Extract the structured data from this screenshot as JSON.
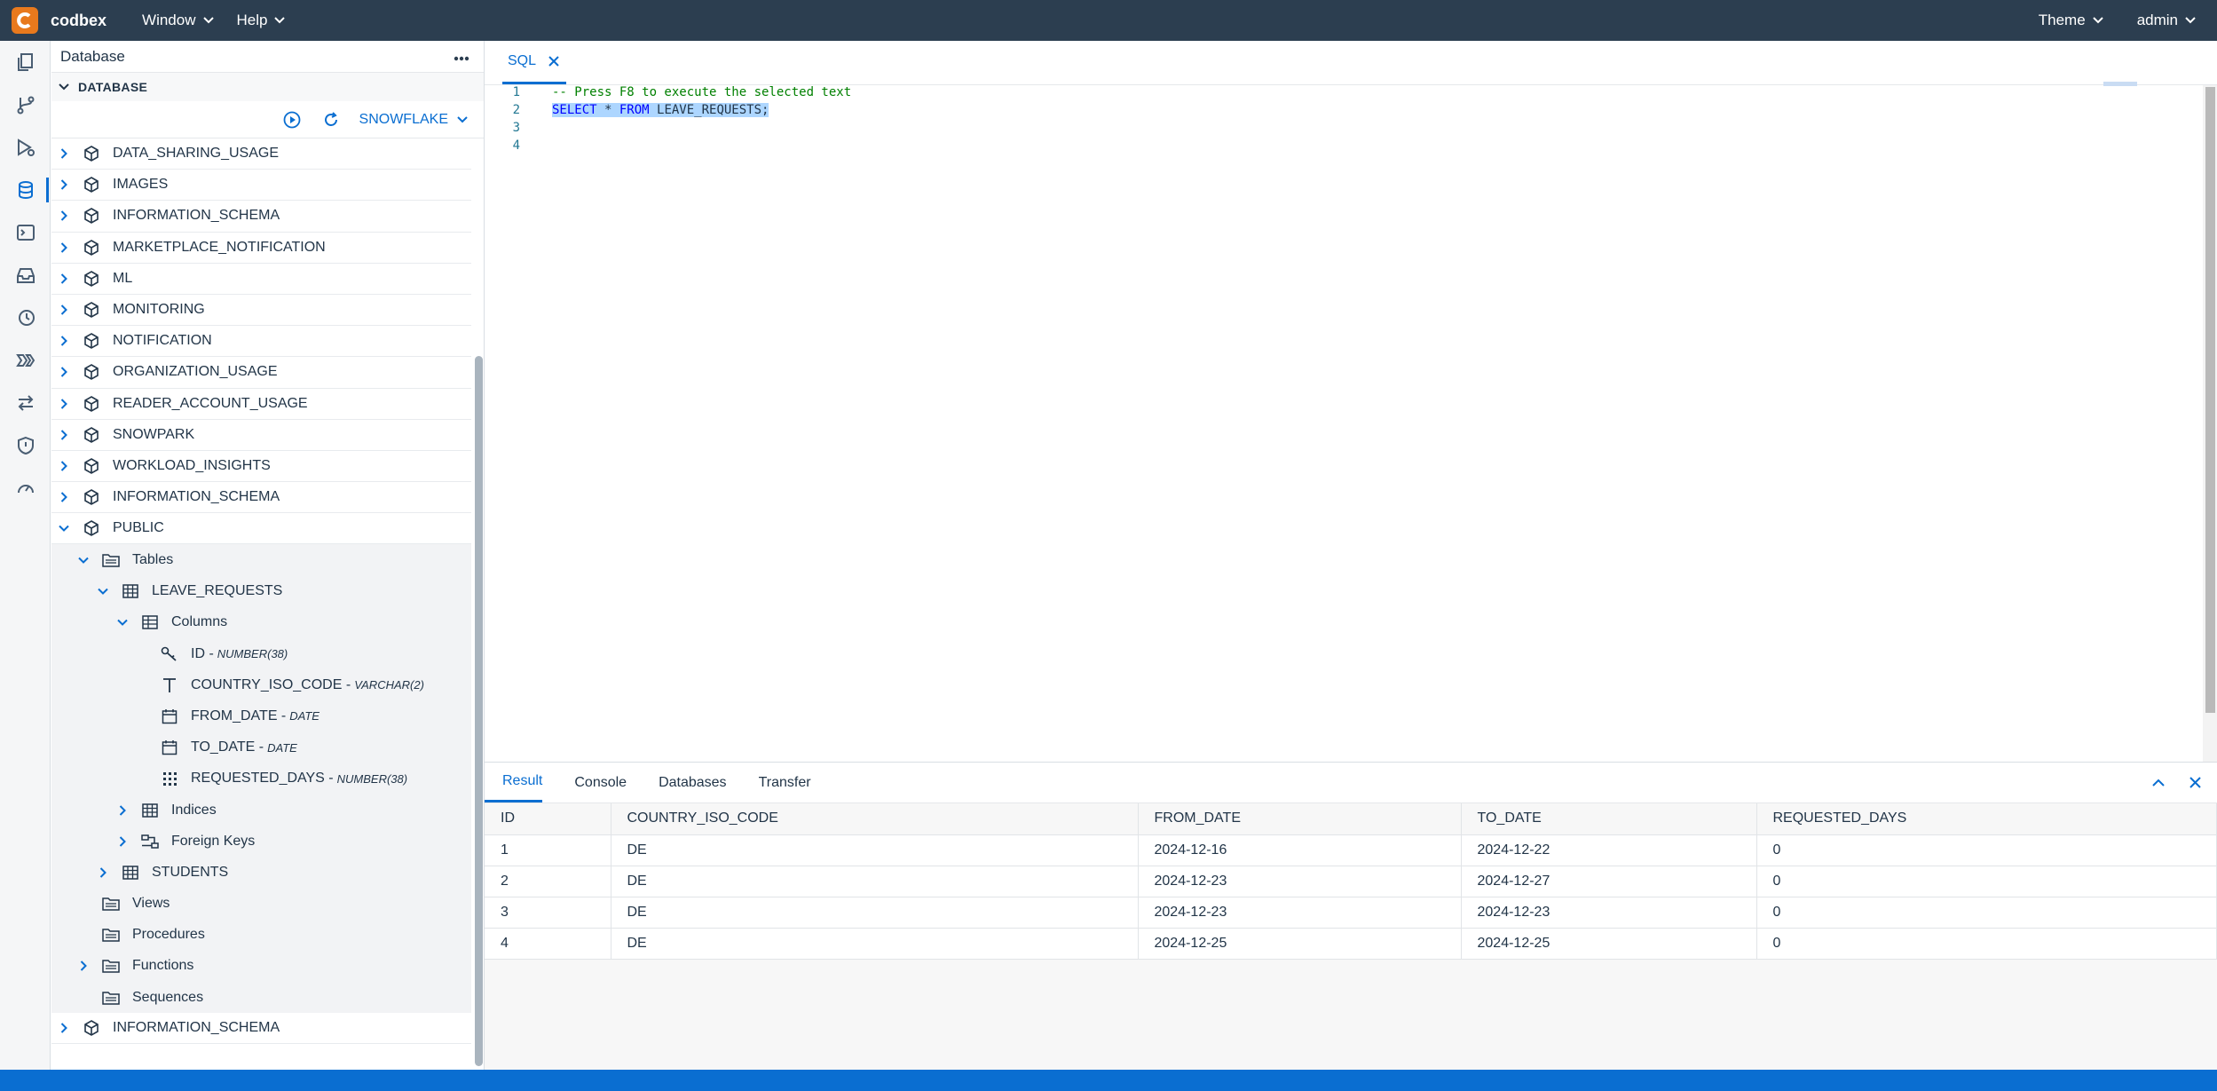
{
  "app": {
    "name": "codbex",
    "menus": [
      "Window",
      "Help"
    ],
    "theme_label": "Theme",
    "user_label": "admin"
  },
  "sidebar": {
    "title": "Database",
    "section": "DATABASE",
    "database_select": "SNOWFLAKE",
    "tree": [
      {
        "label": "DATA_SHARING_USAGE",
        "level": 0,
        "icon": "schema-icon",
        "expanded": false
      },
      {
        "label": "IMAGES",
        "level": 0,
        "icon": "schema-icon",
        "expanded": false
      },
      {
        "label": "INFORMATION_SCHEMA",
        "level": 0,
        "icon": "schema-icon",
        "expanded": false
      },
      {
        "label": "MARKETPLACE_NOTIFICATION",
        "level": 0,
        "icon": "schema-icon",
        "expanded": false
      },
      {
        "label": "ML",
        "level": 0,
        "icon": "schema-icon",
        "expanded": false
      },
      {
        "label": "MONITORING",
        "level": 0,
        "icon": "schema-icon",
        "expanded": false
      },
      {
        "label": "NOTIFICATION",
        "level": 0,
        "icon": "schema-icon",
        "expanded": false
      },
      {
        "label": "ORGANIZATION_USAGE",
        "level": 0,
        "icon": "schema-icon",
        "expanded": false
      },
      {
        "label": "READER_ACCOUNT_USAGE",
        "level": 0,
        "icon": "schema-icon",
        "expanded": false
      },
      {
        "label": "SNOWPARK",
        "level": 0,
        "icon": "schema-icon",
        "expanded": false
      },
      {
        "label": "WORKLOAD_INSIGHTS",
        "level": 0,
        "icon": "schema-icon",
        "expanded": false
      },
      {
        "label": "INFORMATION_SCHEMA",
        "level": 0,
        "icon": "schema-icon",
        "expanded": false
      },
      {
        "label": "PUBLIC",
        "level": 0,
        "icon": "schema-icon",
        "expanded": true
      },
      {
        "label": "Tables",
        "level": 1,
        "icon": "folder-icon",
        "expanded": true,
        "shade": true
      },
      {
        "label": "LEAVE_REQUESTS",
        "level": 2,
        "icon": "table-icon",
        "expanded": true,
        "shade": true
      },
      {
        "label": "Columns",
        "level": 3,
        "icon": "columns-icon",
        "expanded": true,
        "shade": true
      },
      {
        "label": "ID",
        "type": "NUMBER(38)",
        "level": 4,
        "icon": "key-icon",
        "leaf": true,
        "shade": true
      },
      {
        "label": "COUNTRY_ISO_CODE",
        "type": "VARCHAR(2)",
        "level": 4,
        "icon": "text-type-icon",
        "leaf": true,
        "shade": true
      },
      {
        "label": "FROM_DATE",
        "type": "DATE",
        "level": 4,
        "icon": "calendar-icon",
        "leaf": true,
        "shade": true
      },
      {
        "label": "TO_DATE",
        "type": "DATE",
        "level": 4,
        "icon": "calendar-icon",
        "leaf": true,
        "shade": true
      },
      {
        "label": "REQUESTED_DAYS",
        "type": "NUMBER(38)",
        "level": 4,
        "icon": "number-grid-icon",
        "leaf": true,
        "shade": true
      },
      {
        "label": "Indices",
        "level": 3,
        "icon": "table-icon",
        "expanded": false,
        "shade": true
      },
      {
        "label": "Foreign Keys",
        "level": 3,
        "icon": "foreign-key-icon",
        "expanded": false,
        "shade": true
      },
      {
        "label": "STUDENTS",
        "level": 2,
        "icon": "table-icon",
        "expanded": false,
        "shade": true
      },
      {
        "label": "Views",
        "level": 1,
        "icon": "folder-icon",
        "leaf": true,
        "shade": true
      },
      {
        "label": "Procedures",
        "level": 1,
        "icon": "folder-icon",
        "leaf": true,
        "shade": true
      },
      {
        "label": "Functions",
        "level": 1,
        "icon": "folder-icon",
        "expanded": false,
        "shade": true
      },
      {
        "label": "Sequences",
        "level": 1,
        "icon": "folder-icon",
        "leaf": true,
        "shade": true
      },
      {
        "label": "INFORMATION_SCHEMA",
        "level": 0,
        "icon": "schema-icon",
        "expanded": false
      }
    ]
  },
  "editor": {
    "tab_label": "SQL",
    "lines": [
      {
        "num": "1",
        "kind": "comment",
        "text": "-- Press F8 to execute the selected text"
      },
      {
        "num": "2",
        "kind": "sql",
        "parts": [
          [
            "kw",
            "SELECT"
          ],
          [
            "plain",
            " * "
          ],
          [
            "kw",
            "FROM"
          ],
          [
            "plain",
            " LEAVE_REQUESTS;"
          ]
        ]
      },
      {
        "num": "3",
        "kind": "empty",
        "text": ""
      },
      {
        "num": "4",
        "kind": "empty",
        "text": ""
      }
    ]
  },
  "panel": {
    "tabs": [
      "Result",
      "Console",
      "Databases",
      "Transfer"
    ],
    "active_tab": "Result",
    "columns": [
      "ID",
      "COUNTRY_ISO_CODE",
      "FROM_DATE",
      "TO_DATE",
      "REQUESTED_DAYS"
    ],
    "rows": [
      [
        "1",
        "DE",
        "2024-12-16",
        "2024-12-22",
        "0"
      ],
      [
        "2",
        "DE",
        "2024-12-23",
        "2024-12-27",
        "0"
      ],
      [
        "3",
        "DE",
        "2024-12-23",
        "2024-12-23",
        "0"
      ],
      [
        "4",
        "DE",
        "2024-12-25",
        "2024-12-25",
        "0"
      ]
    ]
  },
  "colors": {
    "accent": "#0a6ed1",
    "topbar": "#2c3e50",
    "logo": "#e8791d",
    "selection": "#add6ff"
  }
}
